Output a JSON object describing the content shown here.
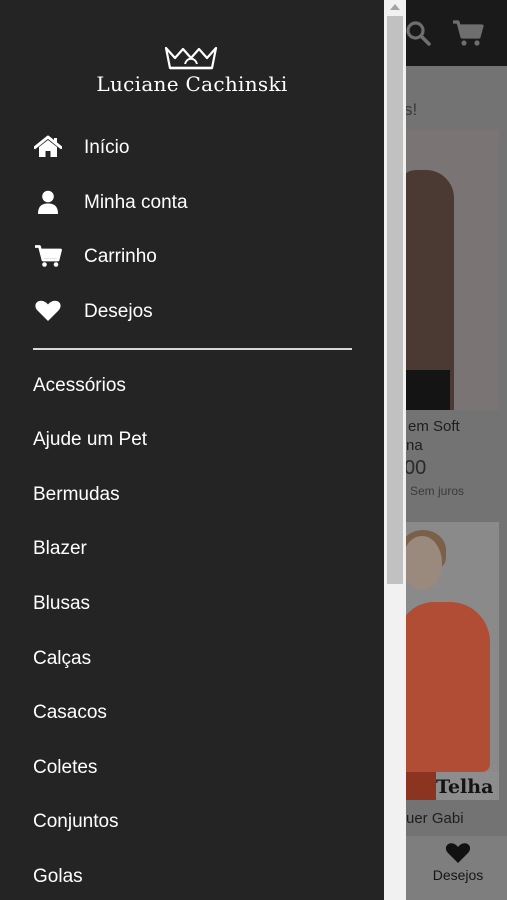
{
  "drawer": {
    "brand_name": "Luciane Cachinski",
    "nav_items": [
      {
        "label": "Início",
        "icon": "home-icon"
      },
      {
        "label": "Minha conta",
        "icon": "user-icon"
      },
      {
        "label": "Carrinho",
        "icon": "cart-icon"
      },
      {
        "label": "Desejos",
        "icon": "heart-icon"
      }
    ],
    "categories": [
      "Acessórios",
      "Ajude um Pet",
      "Bermudas",
      "Blazer",
      "Blusas",
      "Calças",
      "Casacos",
      "Coletes",
      "Conjuntos",
      "Golas"
    ]
  },
  "background_page": {
    "header_icons": [
      "search-icon",
      "cart-icon"
    ],
    "section_heading_fragment": "s!",
    "product_1": {
      "name_line_1": "em Soft",
      "name_line_2": "na",
      "price_fragment": "00",
      "installment_fragment": "Sem juros"
    },
    "product_2": {
      "image_caption": "Telha",
      "name_fragment": "uer Gabi"
    },
    "bottom_nav": {
      "wishlist_label": "Desejos"
    }
  },
  "colors": {
    "drawer_bg": "#242424",
    "header_bg": "#1a1a1a",
    "overlay_tint": "#737373",
    "text": "#ffffff"
  }
}
